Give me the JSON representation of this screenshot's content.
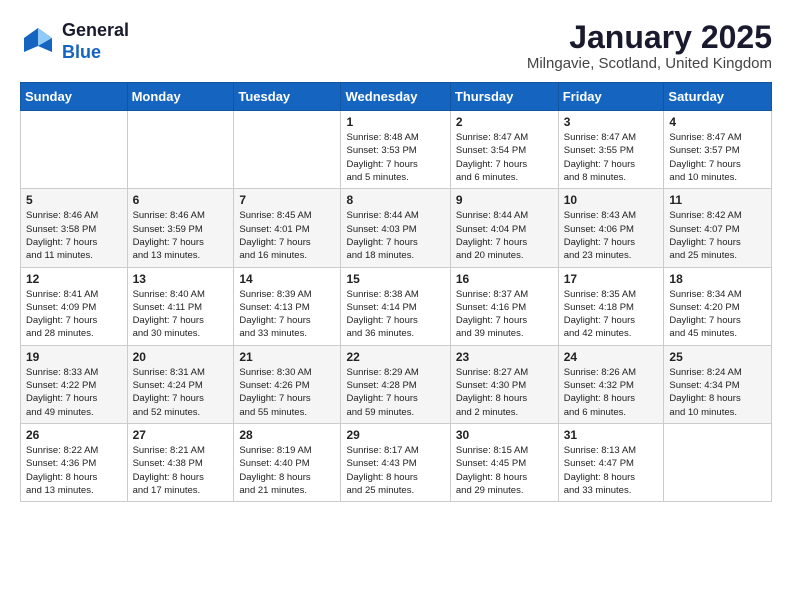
{
  "logo": {
    "line1": "General",
    "line2": "Blue"
  },
  "title": "January 2025",
  "location": "Milngavie, Scotland, United Kingdom",
  "days_of_week": [
    "Sunday",
    "Monday",
    "Tuesday",
    "Wednesday",
    "Thursday",
    "Friday",
    "Saturday"
  ],
  "weeks": [
    [
      {
        "day": "",
        "info": ""
      },
      {
        "day": "",
        "info": ""
      },
      {
        "day": "",
        "info": ""
      },
      {
        "day": "1",
        "info": "Sunrise: 8:48 AM\nSunset: 3:53 PM\nDaylight: 7 hours\nand 5 minutes."
      },
      {
        "day": "2",
        "info": "Sunrise: 8:47 AM\nSunset: 3:54 PM\nDaylight: 7 hours\nand 6 minutes."
      },
      {
        "day": "3",
        "info": "Sunrise: 8:47 AM\nSunset: 3:55 PM\nDaylight: 7 hours\nand 8 minutes."
      },
      {
        "day": "4",
        "info": "Sunrise: 8:47 AM\nSunset: 3:57 PM\nDaylight: 7 hours\nand 10 minutes."
      }
    ],
    [
      {
        "day": "5",
        "info": "Sunrise: 8:46 AM\nSunset: 3:58 PM\nDaylight: 7 hours\nand 11 minutes."
      },
      {
        "day": "6",
        "info": "Sunrise: 8:46 AM\nSunset: 3:59 PM\nDaylight: 7 hours\nand 13 minutes."
      },
      {
        "day": "7",
        "info": "Sunrise: 8:45 AM\nSunset: 4:01 PM\nDaylight: 7 hours\nand 16 minutes."
      },
      {
        "day": "8",
        "info": "Sunrise: 8:44 AM\nSunset: 4:03 PM\nDaylight: 7 hours\nand 18 minutes."
      },
      {
        "day": "9",
        "info": "Sunrise: 8:44 AM\nSunset: 4:04 PM\nDaylight: 7 hours\nand 20 minutes."
      },
      {
        "day": "10",
        "info": "Sunrise: 8:43 AM\nSunset: 4:06 PM\nDaylight: 7 hours\nand 23 minutes."
      },
      {
        "day": "11",
        "info": "Sunrise: 8:42 AM\nSunset: 4:07 PM\nDaylight: 7 hours\nand 25 minutes."
      }
    ],
    [
      {
        "day": "12",
        "info": "Sunrise: 8:41 AM\nSunset: 4:09 PM\nDaylight: 7 hours\nand 28 minutes."
      },
      {
        "day": "13",
        "info": "Sunrise: 8:40 AM\nSunset: 4:11 PM\nDaylight: 7 hours\nand 30 minutes."
      },
      {
        "day": "14",
        "info": "Sunrise: 8:39 AM\nSunset: 4:13 PM\nDaylight: 7 hours\nand 33 minutes."
      },
      {
        "day": "15",
        "info": "Sunrise: 8:38 AM\nSunset: 4:14 PM\nDaylight: 7 hours\nand 36 minutes."
      },
      {
        "day": "16",
        "info": "Sunrise: 8:37 AM\nSunset: 4:16 PM\nDaylight: 7 hours\nand 39 minutes."
      },
      {
        "day": "17",
        "info": "Sunrise: 8:35 AM\nSunset: 4:18 PM\nDaylight: 7 hours\nand 42 minutes."
      },
      {
        "day": "18",
        "info": "Sunrise: 8:34 AM\nSunset: 4:20 PM\nDaylight: 7 hours\nand 45 minutes."
      }
    ],
    [
      {
        "day": "19",
        "info": "Sunrise: 8:33 AM\nSunset: 4:22 PM\nDaylight: 7 hours\nand 49 minutes."
      },
      {
        "day": "20",
        "info": "Sunrise: 8:31 AM\nSunset: 4:24 PM\nDaylight: 7 hours\nand 52 minutes."
      },
      {
        "day": "21",
        "info": "Sunrise: 8:30 AM\nSunset: 4:26 PM\nDaylight: 7 hours\nand 55 minutes."
      },
      {
        "day": "22",
        "info": "Sunrise: 8:29 AM\nSunset: 4:28 PM\nDaylight: 7 hours\nand 59 minutes."
      },
      {
        "day": "23",
        "info": "Sunrise: 8:27 AM\nSunset: 4:30 PM\nDaylight: 8 hours\nand 2 minutes."
      },
      {
        "day": "24",
        "info": "Sunrise: 8:26 AM\nSunset: 4:32 PM\nDaylight: 8 hours\nand 6 minutes."
      },
      {
        "day": "25",
        "info": "Sunrise: 8:24 AM\nSunset: 4:34 PM\nDaylight: 8 hours\nand 10 minutes."
      }
    ],
    [
      {
        "day": "26",
        "info": "Sunrise: 8:22 AM\nSunset: 4:36 PM\nDaylight: 8 hours\nand 13 minutes."
      },
      {
        "day": "27",
        "info": "Sunrise: 8:21 AM\nSunset: 4:38 PM\nDaylight: 8 hours\nand 17 minutes."
      },
      {
        "day": "28",
        "info": "Sunrise: 8:19 AM\nSunset: 4:40 PM\nDaylight: 8 hours\nand 21 minutes."
      },
      {
        "day": "29",
        "info": "Sunrise: 8:17 AM\nSunset: 4:43 PM\nDaylight: 8 hours\nand 25 minutes."
      },
      {
        "day": "30",
        "info": "Sunrise: 8:15 AM\nSunset: 4:45 PM\nDaylight: 8 hours\nand 29 minutes."
      },
      {
        "day": "31",
        "info": "Sunrise: 8:13 AM\nSunset: 4:47 PM\nDaylight: 8 hours\nand 33 minutes."
      },
      {
        "day": "",
        "info": ""
      }
    ]
  ]
}
